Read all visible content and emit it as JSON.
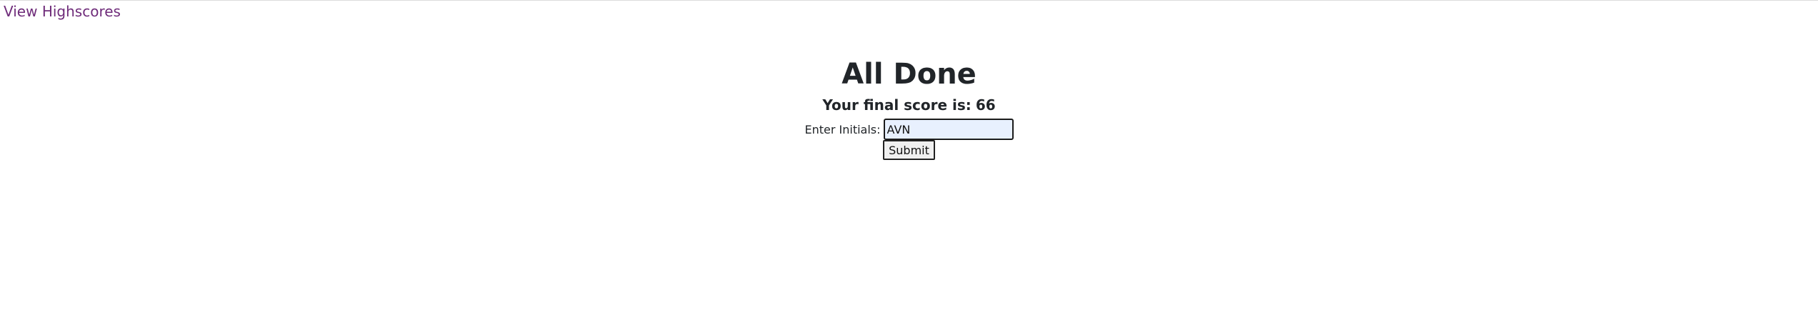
{
  "header": {
    "highscores_link": "View Highscores"
  },
  "results": {
    "title": "All Done",
    "score_label": "Your final score is:",
    "score_value": "66"
  },
  "form": {
    "initials_label": "Enter Initials:",
    "initials_value": "AVN",
    "submit_label": "Submit"
  },
  "colors": {
    "link": "#6f2c7a",
    "input_background": "#e8f0fe",
    "text": "#212529"
  }
}
